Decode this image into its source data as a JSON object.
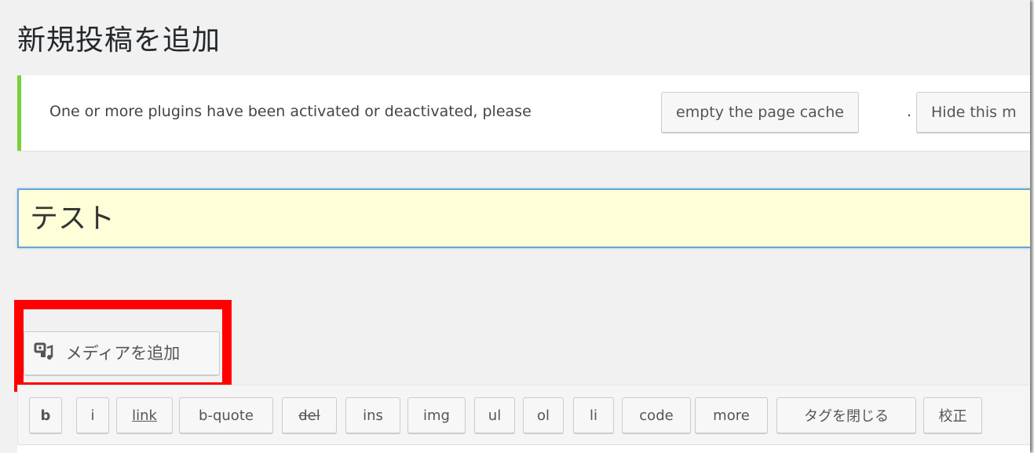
{
  "page": {
    "title": "新規投稿を追加"
  },
  "notice": {
    "message": "One or more plugins have been activated or deactivated, please",
    "cache_button": "empty the page cache",
    "separator": ".",
    "hide_button": "Hide this m",
    "accent_color": "#7ad03a"
  },
  "post": {
    "title_value": "テスト"
  },
  "media": {
    "add_button": "メディアを追加",
    "icon": "media-icon",
    "highlight_color": "#ff0000"
  },
  "quicktags": [
    "b",
    "i",
    "link",
    "b-quote",
    "del",
    "ins",
    "img",
    "ul",
    "ol",
    "li",
    "code",
    "more",
    "タグを閉じる",
    "校正"
  ]
}
